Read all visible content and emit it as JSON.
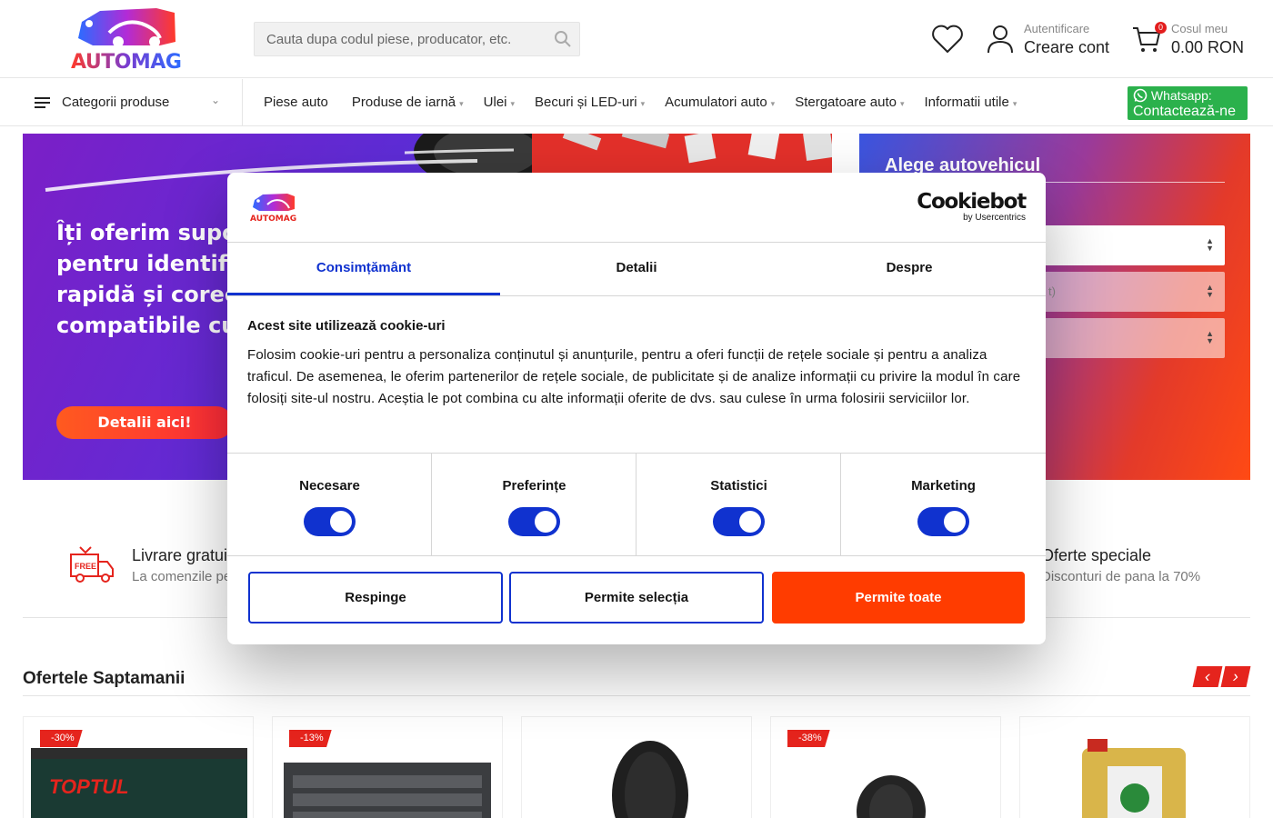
{
  "header": {
    "logo_text": "AUTOMAG",
    "search_placeholder": "Cauta dupa codul piese, producator, etc.",
    "auth_small": "Autentificare",
    "auth_big": "Creare cont",
    "cart_count": "0",
    "cart_small": "Cosul meu",
    "cart_total": "0.00 RON"
  },
  "nav": {
    "categories_label": "Categorii produse",
    "items": [
      {
        "label": "Piese auto",
        "caret": ""
      },
      {
        "label": "Produse de iarnă",
        "caret": "▾"
      },
      {
        "label": "Ulei",
        "caret": "▾"
      },
      {
        "label": "Becuri și LED-uri",
        "caret": "▾"
      },
      {
        "label": "Acumulatori auto",
        "caret": "▾"
      },
      {
        "label": "Stergatoare auto",
        "caret": "▾"
      },
      {
        "label": "Informatii utile",
        "caret": "▾"
      }
    ],
    "whatsapp_line1": "Whatsapp:",
    "whatsapp_line2": "Contactează-ne"
  },
  "hero": {
    "text_lines": [
      "Îți oferim supor",
      "pentru identific",
      "rapidă și corec",
      "compatibile cu"
    ],
    "button": "Detalii aici!"
  },
  "vehicle": {
    "title": "Alege autovehicul",
    "select2_partial": "t)"
  },
  "features": {
    "left_title": "Livrare gratui",
    "left_sub": "La comenzile pe",
    "right_title": "Oferte speciale",
    "right_sub": "Disconturi de pana la 70%"
  },
  "offers": {
    "title": "Ofertele Saptamanii",
    "prev": "‹",
    "next": "›",
    "badges": [
      "-30%",
      "-13%",
      "",
      "-38%",
      ""
    ]
  },
  "cookie": {
    "brand_big": "Cookiebot",
    "brand_small": "by Usercentrics",
    "tabs": [
      "Consimțământ",
      "Detalii",
      "Despre"
    ],
    "heading": "Acest site utilizează cookie-uri",
    "body": "Folosim cookie-uri pentru a personaliza conținutul și anunțurile, pentru a oferi funcții de rețele sociale și pentru a analiza traficul. De asemenea, le oferim partenerilor de rețele sociale, de publicitate și de analize informații cu privire la modul în care folosiți site-ul nostru. Aceștia le pot combina cu alte informații oferite de dvs. sau culese în urma folosirii serviciilor lor.",
    "toggles": [
      "Necesare",
      "Preferințe",
      "Statistici",
      "Marketing"
    ],
    "buttons": {
      "deny": "Respinge",
      "selection": "Permite selecția",
      "all": "Permite toate"
    }
  },
  "colors": {
    "accent": "#1032cf",
    "primary_button": "#ff3c00",
    "brand_red": "#e5241d",
    "whatsapp": "#2bb14c"
  }
}
